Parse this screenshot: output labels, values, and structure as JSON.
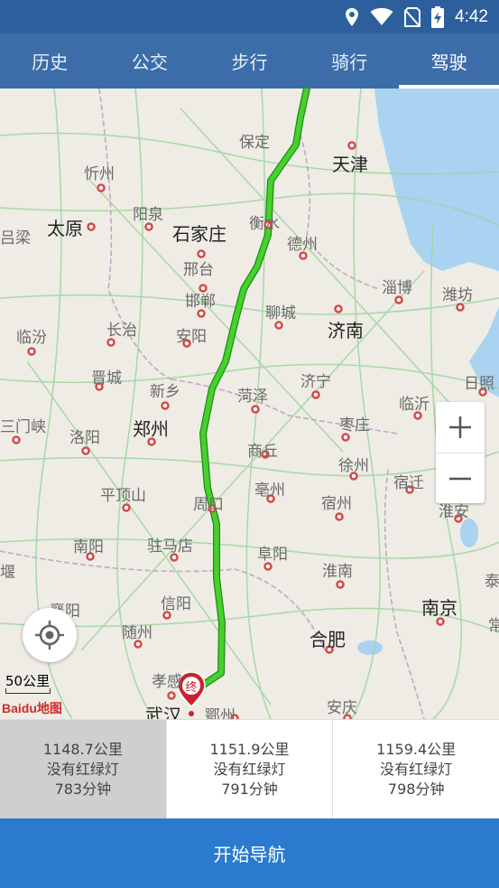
{
  "status": {
    "time": "4:42"
  },
  "tabs": [
    {
      "label": "历史",
      "active": false
    },
    {
      "label": "公交",
      "active": false
    },
    {
      "label": "步行",
      "active": false
    },
    {
      "label": "骑行",
      "active": false
    },
    {
      "label": "驾驶",
      "active": true
    }
  ],
  "map": {
    "cities": {
      "tianjin": "天津",
      "baoding": "保定",
      "xinzhou": "忻州",
      "taiyuan": "太原",
      "yangquan": "阳泉",
      "shijiazhuang": "石家庄",
      "hengshui": "衡水",
      "dezhou": "德州",
      "lvliang": "吕梁",
      "xingtai": "邢台",
      "handan": "邯郸",
      "liaocheng": "聊城",
      "zibo": "淄博",
      "weifang": "潍坊",
      "jinan": "济南",
      "linfen": "临汾",
      "changzhi": "长治",
      "anyang": "安阳",
      "jincheng": "晋城",
      "xinxiang": "新乡",
      "jining": "济宁",
      "heze": "菏泽",
      "linyi": "临沂",
      "rizhao": "日照",
      "sanmenxia": "三门峡",
      "luoyang": "洛阳",
      "zhengzhou": "郑州",
      "zaozhuang": "枣庄",
      "shangqiu": "商丘",
      "xuzhou": "徐州",
      "suqian": "宿迁",
      "pingdingshan": "平顶山",
      "zhoukou": "周口",
      "bozhou": "亳州",
      "suzhou_ah": "宿州",
      "huaian": "淮安",
      "nanyang": "南阳",
      "zhumadian": "驻马店",
      "fuyang": "阜阳",
      "huainan": "淮南",
      "xinyang": "信阳",
      "xiangyang": "襄阳",
      "suizhou": "随州",
      "hefei": "合肥",
      "nanjing": "南京",
      "xiaogan": "孝感",
      "wuhan": "武汉",
      "ezhou": "鄂州",
      "anqing": "安庆",
      "partial_yan": "堰",
      "partial_tai": "泰",
      "partial_chang": "常"
    },
    "end_marker": "终",
    "scale_label": "50公里",
    "logo": "Baidu地图"
  },
  "routes": [
    {
      "distance": "1148.7公里",
      "lights": "没有红绿灯",
      "time": "783分钟",
      "selected": true
    },
    {
      "distance": "1151.9公里",
      "lights": "没有红绿灯",
      "time": "791分钟",
      "selected": false
    },
    {
      "distance": "1159.4公里",
      "lights": "没有红绿灯",
      "time": "798分钟",
      "selected": false
    }
  ],
  "start_nav_label": "开始导航",
  "colors": {
    "header": "#3c6da8",
    "statusbar": "#2d5f9c",
    "route": "#3fc42a",
    "nav_button": "#2a7bd0",
    "marker": "#c8232c"
  }
}
